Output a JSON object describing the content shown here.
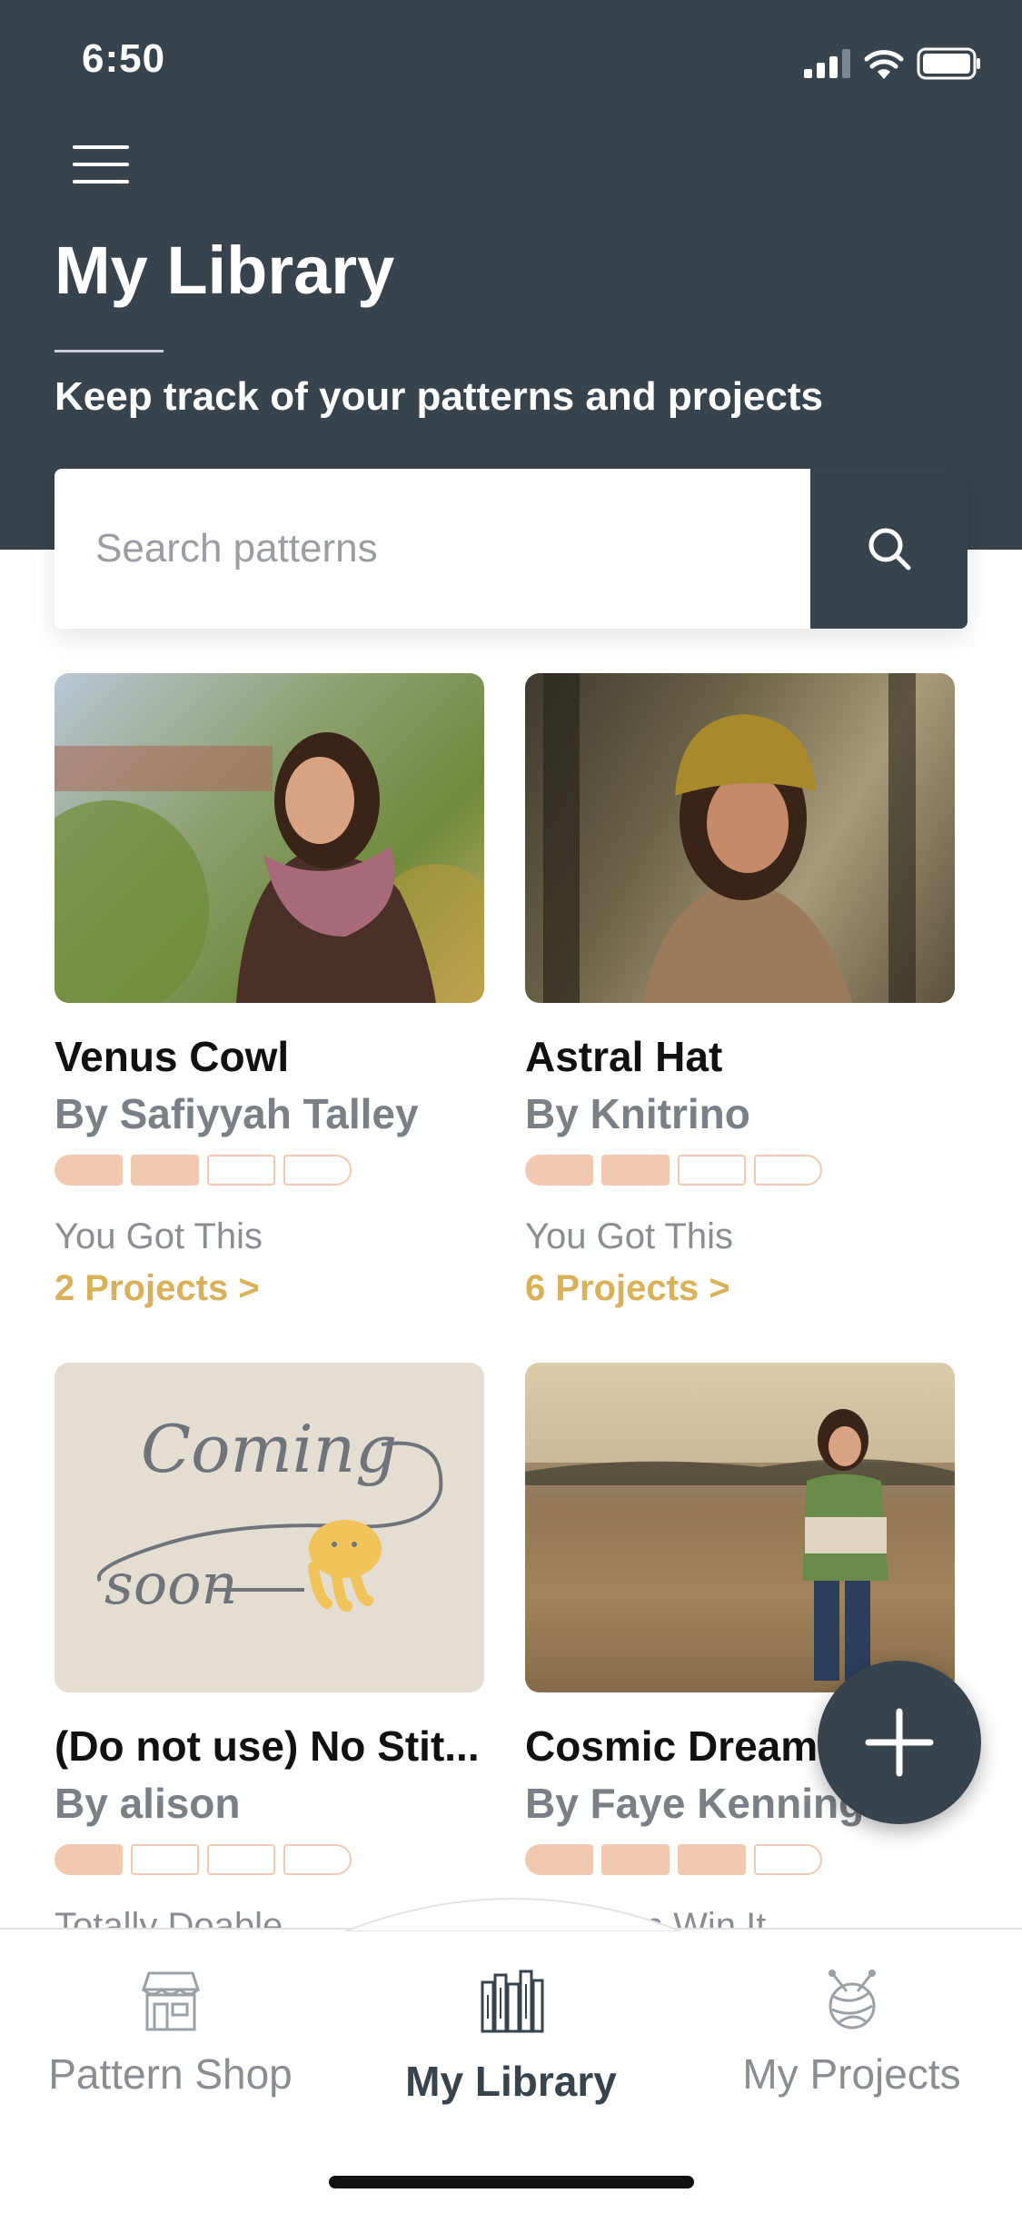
{
  "status_bar": {
    "time": "6:50"
  },
  "header": {
    "title": "My Library",
    "subtitle": "Keep track of your patterns and projects"
  },
  "search": {
    "placeholder": "Search patterns"
  },
  "patterns": [
    {
      "title": "Venus Cowl",
      "author": "By Safiyyah Talley",
      "progress_steps_filled": 2,
      "progress_steps_total": 4,
      "status": "You Got This",
      "projects": "2 Projects >"
    },
    {
      "title": "Astral Hat",
      "author": "By Knitrino",
      "progress_steps_filled": 2,
      "progress_steps_total": 4,
      "status": "You Got This",
      "projects": "6 Projects >"
    },
    {
      "title": "(Do not use) No Stit...",
      "author": "By alison",
      "progress_steps_filled": 1,
      "progress_steps_total": 4,
      "status": "Totally Doable",
      "coming_soon_text": [
        "Coming",
        "soon"
      ]
    },
    {
      "title": "Cosmic Dreamer",
      "author": "By Faye Kennington",
      "progress_steps_filled": 3,
      "progress_steps_total": 4,
      "status": "You Can Win It"
    }
  ],
  "tabs": [
    {
      "label": "Pattern Shop",
      "icon": "shop-icon",
      "active": false
    },
    {
      "label": "My Library",
      "icon": "books-icon",
      "active": true
    },
    {
      "label": "My Projects",
      "icon": "yarn-ball-icon",
      "active": false
    }
  ],
  "colors": {
    "header": "#37434d",
    "accent_gold": "#d9b159",
    "progress_peach": "#f1c8b0"
  }
}
